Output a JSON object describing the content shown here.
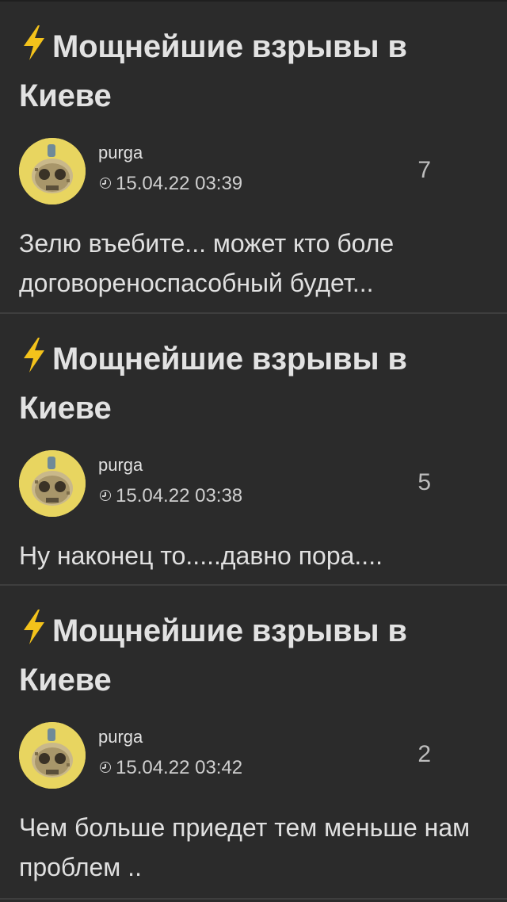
{
  "feed": {
    "items": [
      {
        "title": "Мощнейшие взрывы в Киеве",
        "author": "purga",
        "timestamp": "15.04.22 03:39",
        "count": "7",
        "text": "Зелю въебите... может кто боле договореноспасобный будет..."
      },
      {
        "title": "Мощнейшие взрывы в Киеве",
        "author": "purga",
        "timestamp": "15.04.22 03:38",
        "count": "5",
        "text": "Ну наконец то.....давно пора...."
      },
      {
        "title": "Мощнейшие взрывы в Киеве",
        "author": "purga",
        "timestamp": "15.04.22 03:42",
        "count": "2",
        "text": "Чем больше приедет тем меньше нам проблем .."
      }
    ]
  },
  "colors": {
    "background": "#2b2b2b",
    "divider": "#3e3e3e",
    "bolt": "#f3c21b",
    "avatar_bg": "#e8d560"
  },
  "icons": {
    "title_prefix": "lightning-bolt-icon",
    "time": "clock-icon"
  }
}
